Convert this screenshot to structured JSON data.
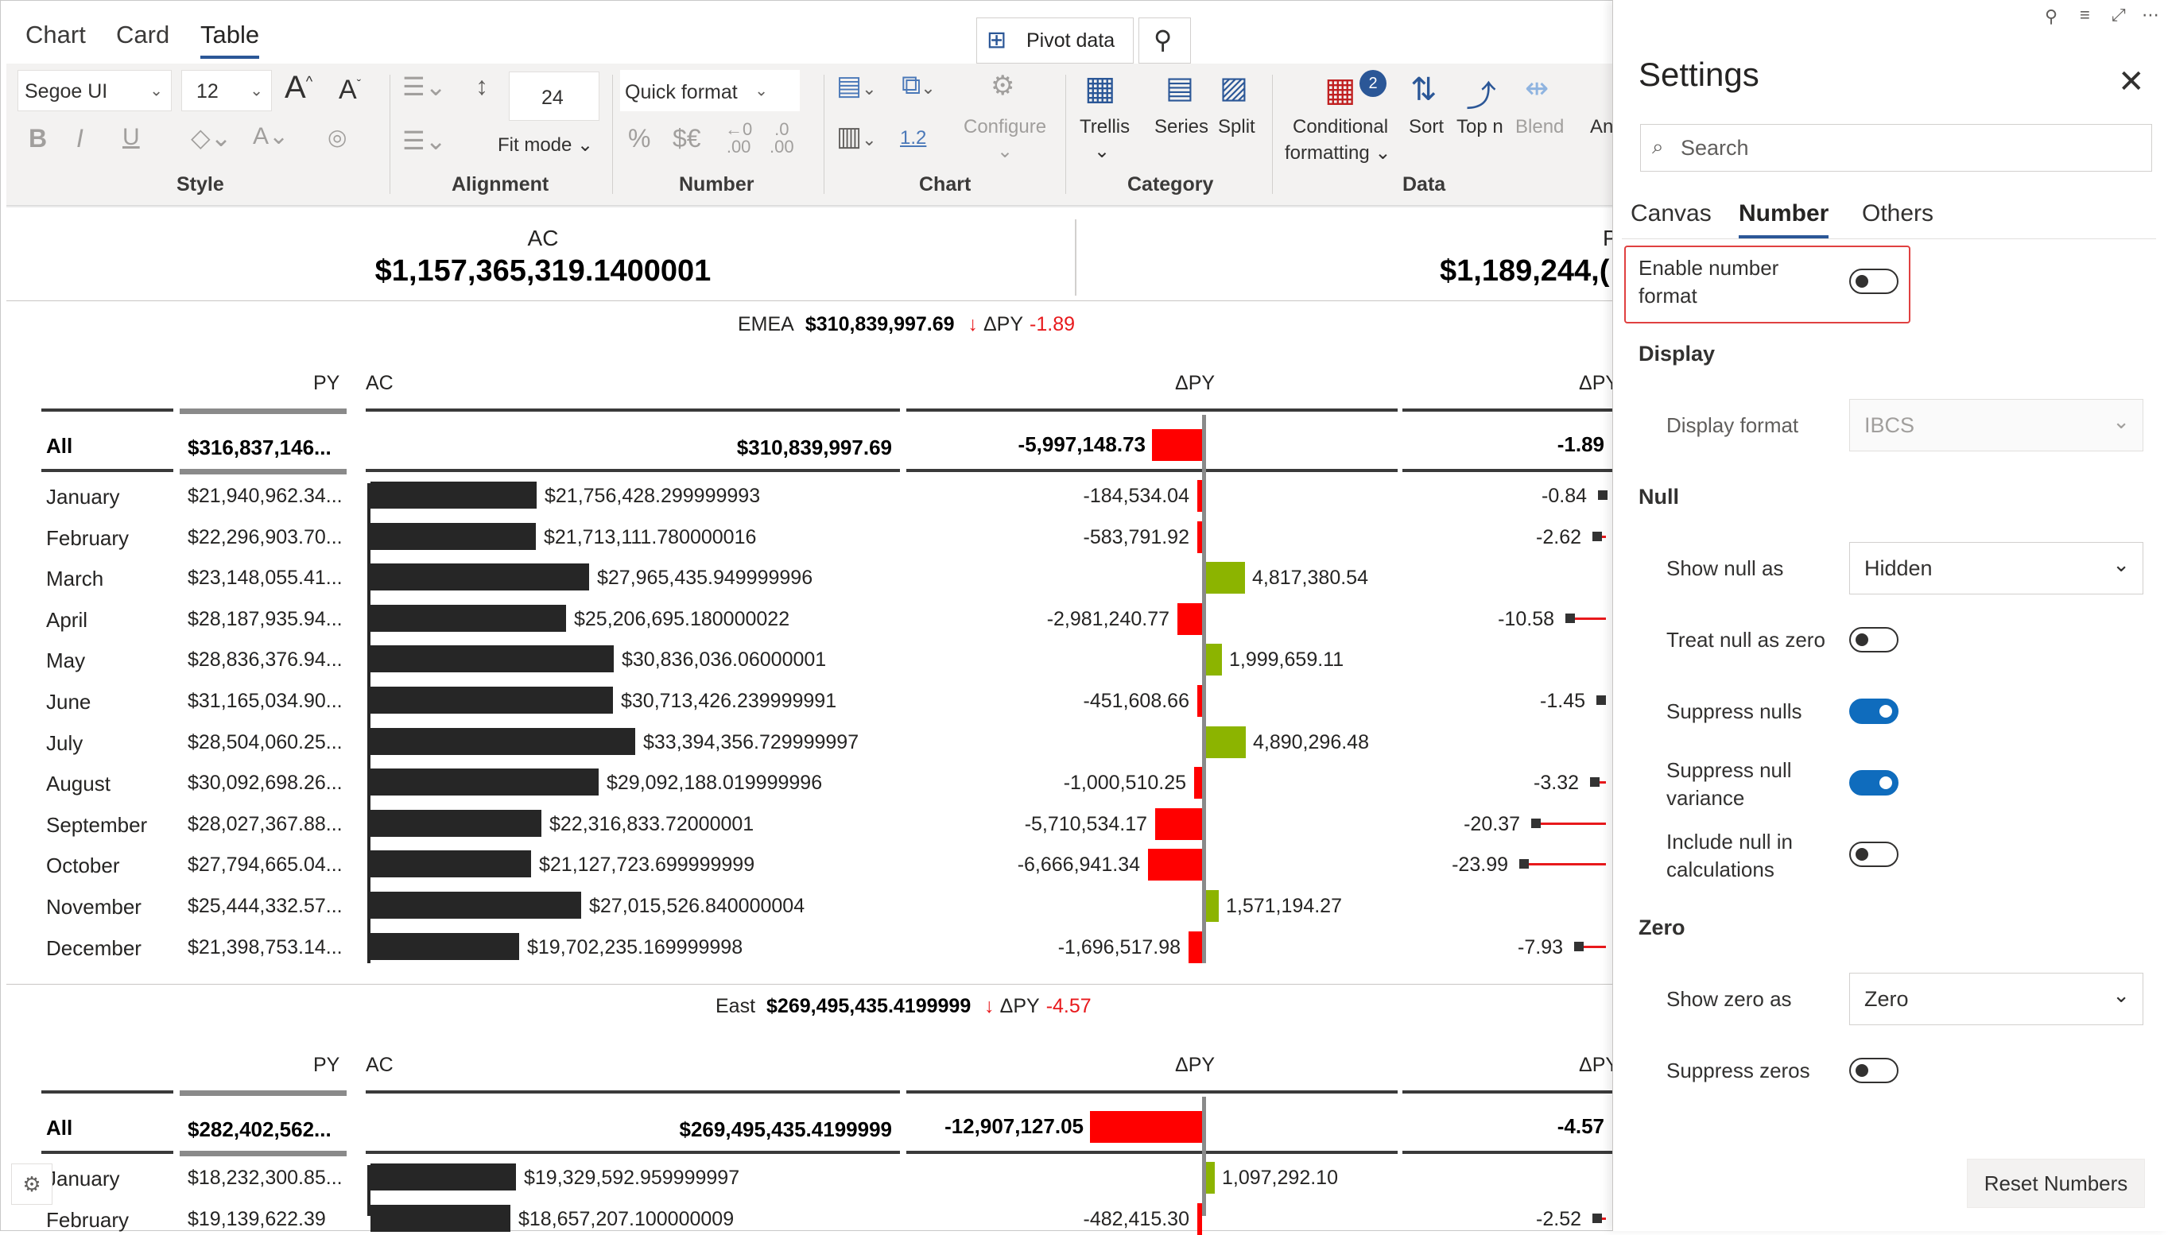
{
  "view_tabs": [
    "Chart",
    "Card",
    "Table"
  ],
  "active_view_tab": "Table",
  "toolbar": {
    "pivot_label": "Pivot data",
    "font_family": "Segoe UI",
    "font_size": "12",
    "row_height": "24",
    "fit_mode": "Fit mode",
    "quick_format": "Quick format",
    "number_decimals_label": "1.2",
    "configure_label": "Configure",
    "trellis_label": "Trellis",
    "series_label": "Series",
    "split_label": "Split",
    "conditional_label_1": "Conditional",
    "conditional_label_2": "formatting",
    "conditional_badge": "2",
    "sort_label": "Sort",
    "topn_label": "Top n",
    "blend_label": "Blend",
    "an_label": "An",
    "groups": {
      "style": "Style",
      "alignment": "Alignment",
      "number": "Number",
      "chart": "Chart",
      "category": "Category",
      "data": "Data"
    }
  },
  "kpi": {
    "ac_label": "AC",
    "ac_value": "$1,157,365,319.1400001",
    "py_label": "P",
    "py_value": "$1,189,244,("
  },
  "sections": [
    {
      "region": "EMEA",
      "total": "$310,839,997.69",
      "delta_label": "ΔPY",
      "delta_value": "-1.89",
      "headers": {
        "py": "PY",
        "ac": "AC",
        "dpy": "ΔPY",
        "dpy_pct": "ΔPY"
      },
      "all_row": {
        "label": "All",
        "py": "$316,837,146...",
        "ac": "$310,839,997.69",
        "dpy": "-5,997,148.73",
        "dpy_pct": "-1.89"
      },
      "rows": [
        {
          "month": "January",
          "py": "$21,940,962.34...",
          "ac": "$21,756,428.299999993",
          "ac_num": 21756428.3,
          "dpy": "-184,534.04",
          "dpy_num": -184534.04,
          "pct": "-0.84",
          "pct_num": -0.84
        },
        {
          "month": "February",
          "py": "$22,296,903.70...",
          "ac": "$21,713,111.780000016",
          "ac_num": 21713111.78,
          "dpy": "-583,791.92",
          "dpy_num": -583791.92,
          "pct": "-2.62",
          "pct_num": -2.62
        },
        {
          "month": "March",
          "py": "$23,148,055.41...",
          "ac": "$27,965,435.949999996",
          "ac_num": 27965435.95,
          "dpy": "4,817,380.54",
          "dpy_num": 4817380.54,
          "pct": "",
          "pct_num": 0
        },
        {
          "month": "April",
          "py": "$28,187,935.94...",
          "ac": "$25,206,695.180000022",
          "ac_num": 25206695.18,
          "dpy": "-2,981,240.77",
          "dpy_num": -2981240.77,
          "pct": "-10.58",
          "pct_num": -10.58
        },
        {
          "month": "May",
          "py": "$28,836,376.94...",
          "ac": "$30,836,036.06000001",
          "ac_num": 30836036.06,
          "dpy": "1,999,659.11",
          "dpy_num": 1999659.11,
          "pct": "",
          "pct_num": 0
        },
        {
          "month": "June",
          "py": "$31,165,034.90...",
          "ac": "$30,713,426.239999991",
          "ac_num": 30713426.24,
          "dpy": "-451,608.66",
          "dpy_num": -451608.66,
          "pct": "-1.45",
          "pct_num": -1.45
        },
        {
          "month": "July",
          "py": "$28,504,060.25...",
          "ac": "$33,394,356.729999997",
          "ac_num": 33394356.73,
          "dpy": "4,890,296.48",
          "dpy_num": 4890296.48,
          "pct": "",
          "pct_num": 0
        },
        {
          "month": "August",
          "py": "$30,092,698.26...",
          "ac": "$29,092,188.019999996",
          "ac_num": 29092188.02,
          "dpy": "-1,000,510.25",
          "dpy_num": -1000510.25,
          "pct": "-3.32",
          "pct_num": -3.32
        },
        {
          "month": "September",
          "py": "$28,027,367.88...",
          "ac": "$22,316,833.72000001",
          "ac_num": 22316833.72,
          "dpy": "-5,710,534.17",
          "dpy_num": -5710534.17,
          "pct": "-20.37",
          "pct_num": -20.37
        },
        {
          "month": "October",
          "py": "$27,794,665.04...",
          "ac": "$21,127,723.699999999",
          "ac_num": 21127723.7,
          "dpy": "-6,666,941.34",
          "dpy_num": -6666941.34,
          "pct": "-23.99",
          "pct_num": -23.99
        },
        {
          "month": "November",
          "py": "$25,444,332.57...",
          "ac": "$27,015,526.840000004",
          "ac_num": 27015526.84,
          "dpy": "1,571,194.27",
          "dpy_num": 1571194.27,
          "pct": "",
          "pct_num": 0
        },
        {
          "month": "December",
          "py": "$21,398,753.14...",
          "ac": "$19,702,235.169999998",
          "ac_num": 19702235.17,
          "dpy": "-1,696,517.98",
          "dpy_num": -1696517.98,
          "pct": "-7.93",
          "pct_num": -7.93
        }
      ]
    },
    {
      "region": "East",
      "total": "$269,495,435.4199999",
      "delta_label": "ΔPY",
      "delta_value": "-4.57",
      "headers": {
        "py": "PY",
        "ac": "AC",
        "dpy": "ΔPY",
        "dpy_pct": "ΔPY"
      },
      "all_row": {
        "label": "All",
        "py": "$282,402,562...",
        "ac": "$269,495,435.4199999",
        "dpy": "-12,907,127.05",
        "dpy_pct": "-4.57"
      },
      "rows": [
        {
          "month": "January",
          "py": "$18,232,300.85...",
          "ac": "$19,329,592.959999997",
          "ac_num": 19329592.96,
          "dpy": "1,097,292.10",
          "dpy_num": 1097292.1,
          "pct": "",
          "pct_num": 0
        },
        {
          "month": "February",
          "py": "$19,139,622.39",
          "ac": "$18,657,207.100000009",
          "ac_num": 18657207.1,
          "dpy": "-482,415.30",
          "dpy_num": -482415.3,
          "pct": "-2.52",
          "pct_num": -2.52
        }
      ]
    }
  ],
  "settings": {
    "title": "Settings",
    "search_placeholder": "Search",
    "tabs": [
      "Canvas",
      "Number",
      "Others"
    ],
    "active_tab": "Number",
    "enable_number_format": {
      "label": "Enable number format",
      "on": false
    },
    "display": {
      "heading": "Display",
      "format_label": "Display format",
      "format_value": "IBCS"
    },
    "null": {
      "heading": "Null",
      "show_null_as_label": "Show null as",
      "show_null_as_value": "Hidden",
      "treat_null_as_zero": {
        "label": "Treat null as zero",
        "on": false
      },
      "suppress_nulls": {
        "label": "Suppress nulls",
        "on": true
      },
      "suppress_null_variance": {
        "label": "Suppress null variance",
        "on": true
      },
      "include_null_in_calculations": {
        "label": "Include null in calculations",
        "on": false
      }
    },
    "zero": {
      "heading": "Zero",
      "show_zero_as_label": "Show zero as",
      "show_zero_as_value": "Zero",
      "suppress_zeros": {
        "label": "Suppress zeros",
        "on": false
      }
    },
    "reset_label": "Reset Numbers"
  },
  "colors": {
    "accent": "#0f6cbd",
    "negative": "#ff0000",
    "positive": "#8cb400",
    "bar": "#262626",
    "highlight": "#e04040"
  }
}
